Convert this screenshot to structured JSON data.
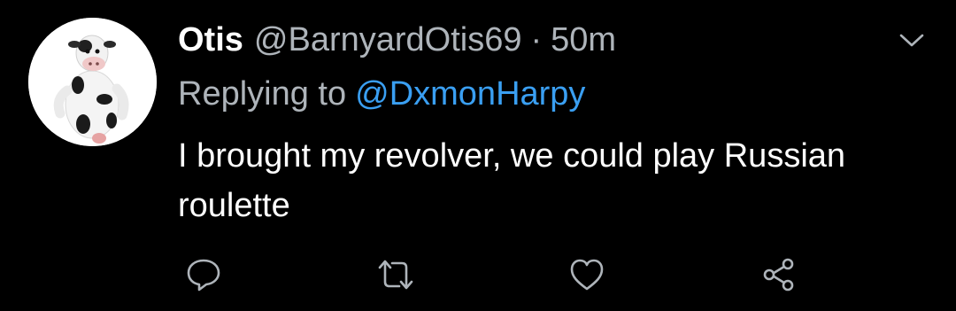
{
  "tweet": {
    "display_name": "Otis",
    "handle": "@BarnyardOtis69",
    "separator": "·",
    "time": "50m",
    "replying_label": "Replying to",
    "replying_to": "@DxmonHarpy",
    "text": "I brought my revolver, we could play Russian roulette"
  },
  "icons": {
    "menu": "chevron-down-icon",
    "reply": "reply-icon",
    "retweet": "retweet-icon",
    "like": "heart-icon",
    "share": "share-icon"
  },
  "colors": {
    "background": "#000000",
    "primary_text": "#ffffff",
    "secondary_text": "#aeb4ba",
    "mention": "#3a9ff2",
    "icon": "#aeb4ba"
  }
}
